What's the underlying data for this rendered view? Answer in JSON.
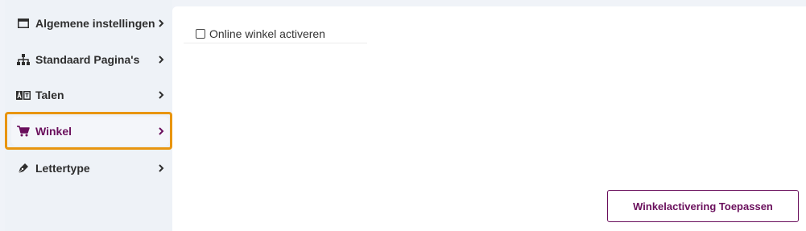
{
  "sidebar": {
    "items": [
      {
        "label": "Algemene instellingen",
        "icon": "window-icon",
        "active": false
      },
      {
        "label": "Standaard Pagina's",
        "icon": "sitemap-icon",
        "active": false
      },
      {
        "label": "Talen",
        "icon": "language-icon",
        "active": false
      },
      {
        "label": "Winkel",
        "icon": "cart-icon",
        "active": true
      },
      {
        "label": "Lettertype",
        "icon": "pen-icon",
        "active": false
      }
    ]
  },
  "main": {
    "checkbox_label": "Online winkel activeren",
    "checkbox_checked": false,
    "apply_button_label": "Winkelactivering Toepassen"
  },
  "colors": {
    "accent": "#6a0f5c",
    "highlight": "#e8950f",
    "sidebar_bg": "#eef2f7"
  }
}
